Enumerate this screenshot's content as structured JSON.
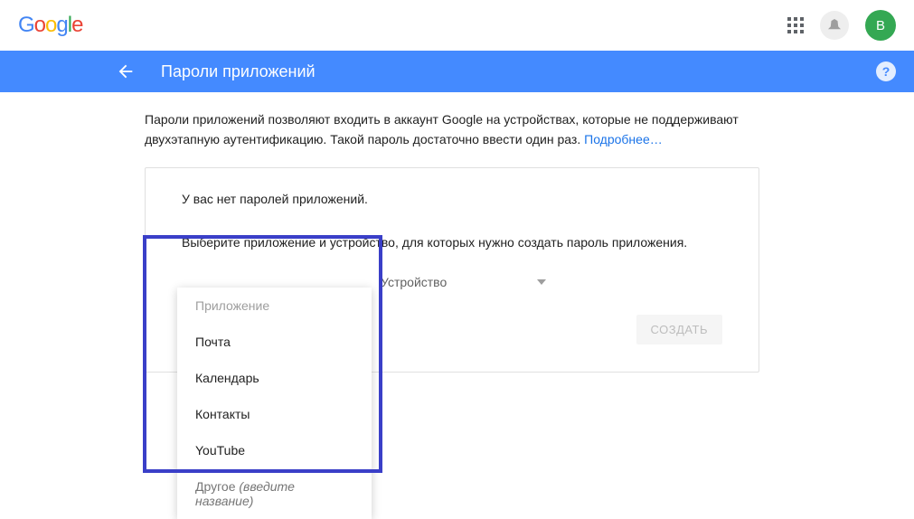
{
  "header": {
    "logo": "Google",
    "avatar_letter": "В"
  },
  "blueBar": {
    "title": "Пароли приложений"
  },
  "description": {
    "text": "Пароли приложений позволяют входить в аккаунт Google на устройствах, которые не поддерживают двухэтапную аутентификацию. Такой пароль достаточно ввести один раз.",
    "learn_more": "Подробнее…"
  },
  "card": {
    "no_passwords": "У вас нет паролей приложений.",
    "instruction": "Выберите приложение и устройство, для которых нужно создать пароль приложения.",
    "device_label": "Устройство",
    "create_button": "СОЗДАТЬ"
  },
  "dropdown": {
    "header": "Приложение",
    "items": [
      "Почта",
      "Календарь",
      "Контакты",
      "YouTube"
    ],
    "other_prefix": "Другое ",
    "other_hint": "(введите название)"
  }
}
